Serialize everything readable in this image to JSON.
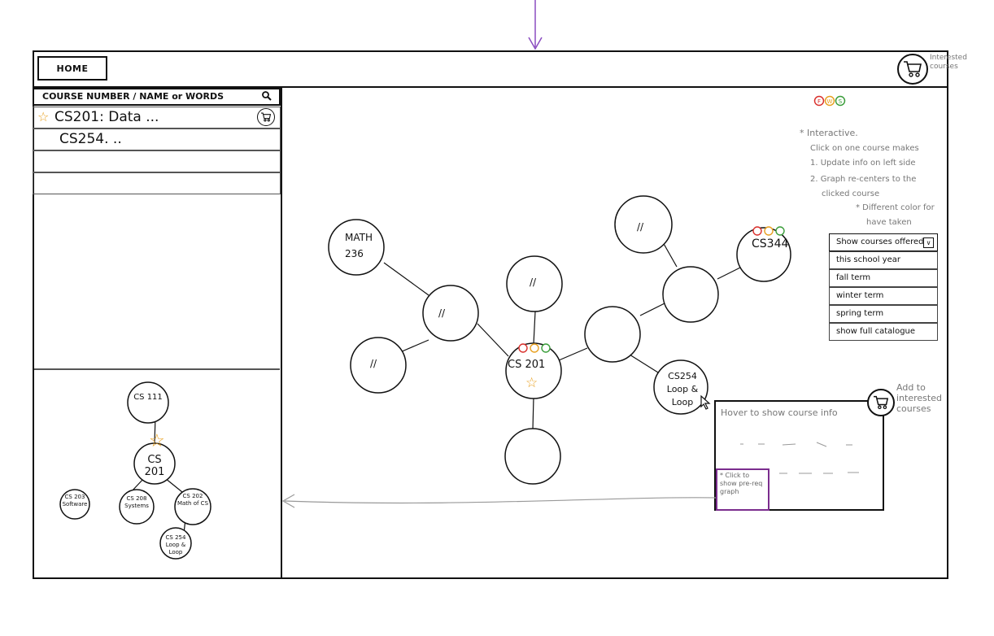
{
  "header": {
    "home_label": "HOME",
    "cart_note": "Interested courses"
  },
  "search": {
    "label": "COURSE NUMBER / NAME or WORDS",
    "icon": "search-icon"
  },
  "results": [
    {
      "label": "CS201: Data ...",
      "starred": true,
      "has_cart": true
    },
    {
      "label": "CS254. ..",
      "starred": false,
      "has_cart": false
    },
    {
      "label": "",
      "starred": false,
      "has_cart": false
    },
    {
      "label": "",
      "starred": false,
      "has_cart": false
    }
  ],
  "term_badges": [
    "F",
    "W",
    "S"
  ],
  "colors": {
    "fall": "#d9302c",
    "winter": "#e8a020",
    "spring": "#3a9d3a",
    "star": "#e8a020",
    "arrow": "#8a4cc0",
    "prereq_border": "#7b2d8e"
  },
  "notes": {
    "interactive_title": "* Interactive.",
    "line1": "Click on one course makes",
    "line2": "1. Update info on left side",
    "line3": "2. Graph re-centers to the",
    "line4": "clicked course",
    "line5": "* Different color for",
    "line6": "have taken"
  },
  "dropdown": {
    "selected": "Show courses offered",
    "options": [
      "this school year",
      "fall term",
      "winter term",
      "spring term",
      "show full catalogue"
    ]
  },
  "graph_nodes": {
    "math": "MATH 236",
    "cs201": "CS 201",
    "cs254": "CS254 Loop & Loop",
    "cs344": "CS344",
    "placeholder": "//"
  },
  "hover": {
    "title": "Hover to show course info",
    "add_note": "Add to interested courses",
    "prereq_note": "* Click to show pre-req graph"
  },
  "mini_graph": {
    "cs111": "CS 111",
    "cs201": "CS 201",
    "cs203": "CS 203 Software",
    "cs208": "CS 208 Systems",
    "cs202": "CS 202 Math of CS",
    "cs254": "CS 254 Loop & Loop"
  }
}
